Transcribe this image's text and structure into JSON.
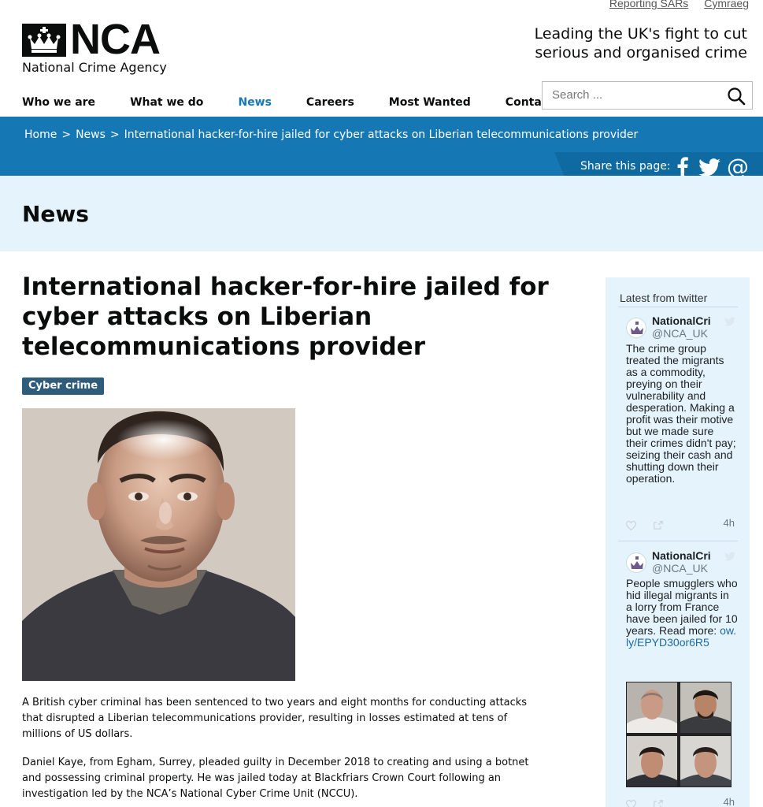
{
  "utility_links": [
    "Reporting SARs",
    "Cymraeg"
  ],
  "logo": {
    "text": "NCA",
    "subtitle": "National Crime Agency"
  },
  "tagline": "Leading the UK's fight to cut serious and organised crime",
  "nav": [
    "Who we are",
    "What we do",
    "News",
    "Careers",
    "Most Wanted",
    "Contact us"
  ],
  "nav_active": "News",
  "search": {
    "placeholder": "Search ..."
  },
  "breadcrumb": [
    "Home",
    "News",
    "International hacker-for-hire jailed for cyber attacks on Liberian telecommunications provider"
  ],
  "breadcrumb_separator": ">",
  "share_label": "Share this page:",
  "section_title": "News",
  "article": {
    "title": "International hacker-for-hire jailed for cyber attacks on Liberian telecommunications provider",
    "tag": "Cyber crime",
    "paragraphs": [
      "A British cyber criminal has been sentenced to two years and eight months for conducting attacks that disrupted a Liberian telecommunications provider, resulting in losses estimated at tens of millions of US dollars.",
      "Daniel Kaye, from Egham, Surrey, pleaded guilty in December 2018 to creating and using a botnet and possessing criminal property. He was jailed today at Blackfriars Crown Court following an investigation led by the NCA’s National Cyber Crime Unit (NCCU)."
    ]
  },
  "twitter": {
    "heading": "Latest from twitter",
    "tweets": [
      {
        "name": "NationalCri",
        "handle": "@NCA_UK",
        "text": "The crime group treated the migrants as a commodity, preying on their vulnerability and desperation. Making a profit was their motive but we made sure their crimes didn't pay; seizing their cash and shutting down their operation.",
        "time": "4h"
      },
      {
        "name": "NationalCri",
        "handle": "@NCA_UK",
        "text": "People smugglers who hid illegal migrants in a lorry from France have been jailed for 10 years. Read more: ",
        "link": "ow.ly/EPYD30or6R5",
        "time": "4h"
      }
    ]
  },
  "colors": {
    "brand_blue": "#1577b4",
    "light_band": "#e5f3fc",
    "tag_bg": "#2e5c7a"
  }
}
